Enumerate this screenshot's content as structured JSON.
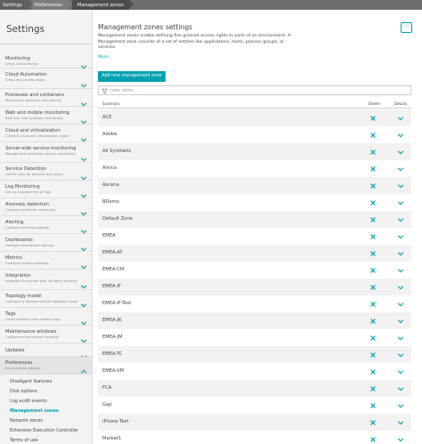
{
  "breadcrumb": [
    "Settings",
    "Preferences",
    "Management zones"
  ],
  "sidebar": {
    "title": "Settings",
    "items": [
      {
        "name": "Monitoring",
        "desc": "Setup and overview"
      },
      {
        "name": "Cloud Automation",
        "desc": "Setup and configuration"
      },
      {
        "name": "Processes and containers",
        "desc": "Monitoring, detection and naming"
      },
      {
        "name": "Web and mobile monitoring",
        "desc": "Real user and synthetic monitoring"
      },
      {
        "name": "Cloud and virtualization",
        "desc": "Connect cloud and virtualization types"
      },
      {
        "name": "Server-side service monitoring",
        "desc": "Manage and customize service monitoring"
      },
      {
        "name": "Service Detection",
        "desc": "Define rules for services and spans"
      },
      {
        "name": "Log Monitoring",
        "desc": "Set up management of logs"
      },
      {
        "name": "Anomaly detection",
        "desc": "Configure detection sensitivity"
      },
      {
        "name": "Alerting",
        "desc": "Configure alerting settings"
      },
      {
        "name": "Dashboards",
        "desc": "Configure dashboard settings"
      },
      {
        "name": "Metrics",
        "desc": "Configure metrics settings"
      },
      {
        "name": "Integration",
        "desc": "Integrate Dynatrace with 3rd party systems"
      },
      {
        "name": "Topology model",
        "desc": "Configure a domain-specific topology model"
      },
      {
        "name": "Tags",
        "desc": "Group entities using custom tags"
      },
      {
        "name": "Maintenance windows",
        "desc": "Configure maintenance windows"
      },
      {
        "name": "Updates",
        "desc": ""
      },
      {
        "name": "Preferences",
        "desc": "Environment settings"
      }
    ],
    "subitems": [
      "OneAgent features",
      "Disk options",
      "Log audit events",
      "Management zones",
      "Network zones",
      "Extension Execution Controller",
      "Terms of use"
    ]
  },
  "main": {
    "title": "Management zones settings",
    "menu_label": "···",
    "description": "Management zones enable defining fine grained access rights to parts of an environment. A Management zone consists of a set of entities like applications, hosts, process groups, or services.",
    "more_link": "More...",
    "add_button": "Add new management zone",
    "filter_placeholder": "Filter items...",
    "columns": {
      "summary": "Summary",
      "delete": "Delete",
      "details": "Details"
    },
    "rows": [
      "ACE",
      "Adobe",
      "All Synthetic",
      "Amica",
      "Ascena",
      "BDemo",
      "Default Zone",
      "EMEA",
      "EMEA-AT",
      "EMEA-CM",
      "EMEA-IF",
      "EMEA-IF-Test",
      "EMEA-JK",
      "EMEA-JM",
      "EMEA-TC",
      "EMEA-VM",
      "FCA",
      "Gap",
      "iPhone Test",
      "Market1"
    ]
  },
  "colors": {
    "accent": "#00a1b2",
    "text": "#454646",
    "sidebar_bg": "#f3f3f3"
  }
}
